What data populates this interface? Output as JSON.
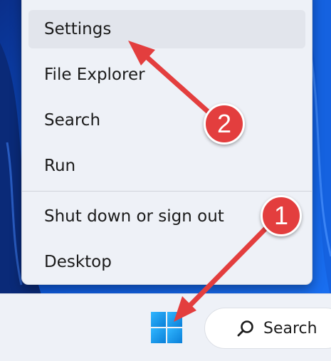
{
  "menu": {
    "items": [
      {
        "label": "Settings",
        "highlighted": true
      },
      {
        "label": "File Explorer",
        "highlighted": false
      },
      {
        "label": "Search",
        "highlighted": false
      },
      {
        "label": "Run",
        "highlighted": false
      },
      {
        "label": "Shut down or sign out",
        "highlighted": false
      },
      {
        "label": "Desktop",
        "highlighted": false
      }
    ]
  },
  "taskbar": {
    "search_label": "Search",
    "start_icon": "windows-logo-icon"
  },
  "annotations": {
    "step1_label": "1",
    "step2_label": "2"
  },
  "colors": {
    "accent": "#0078d4",
    "annotation_red": "#e33e3e",
    "menu_background": "#eef1f7",
    "wallpaper_blue": "#0b3fa6"
  }
}
